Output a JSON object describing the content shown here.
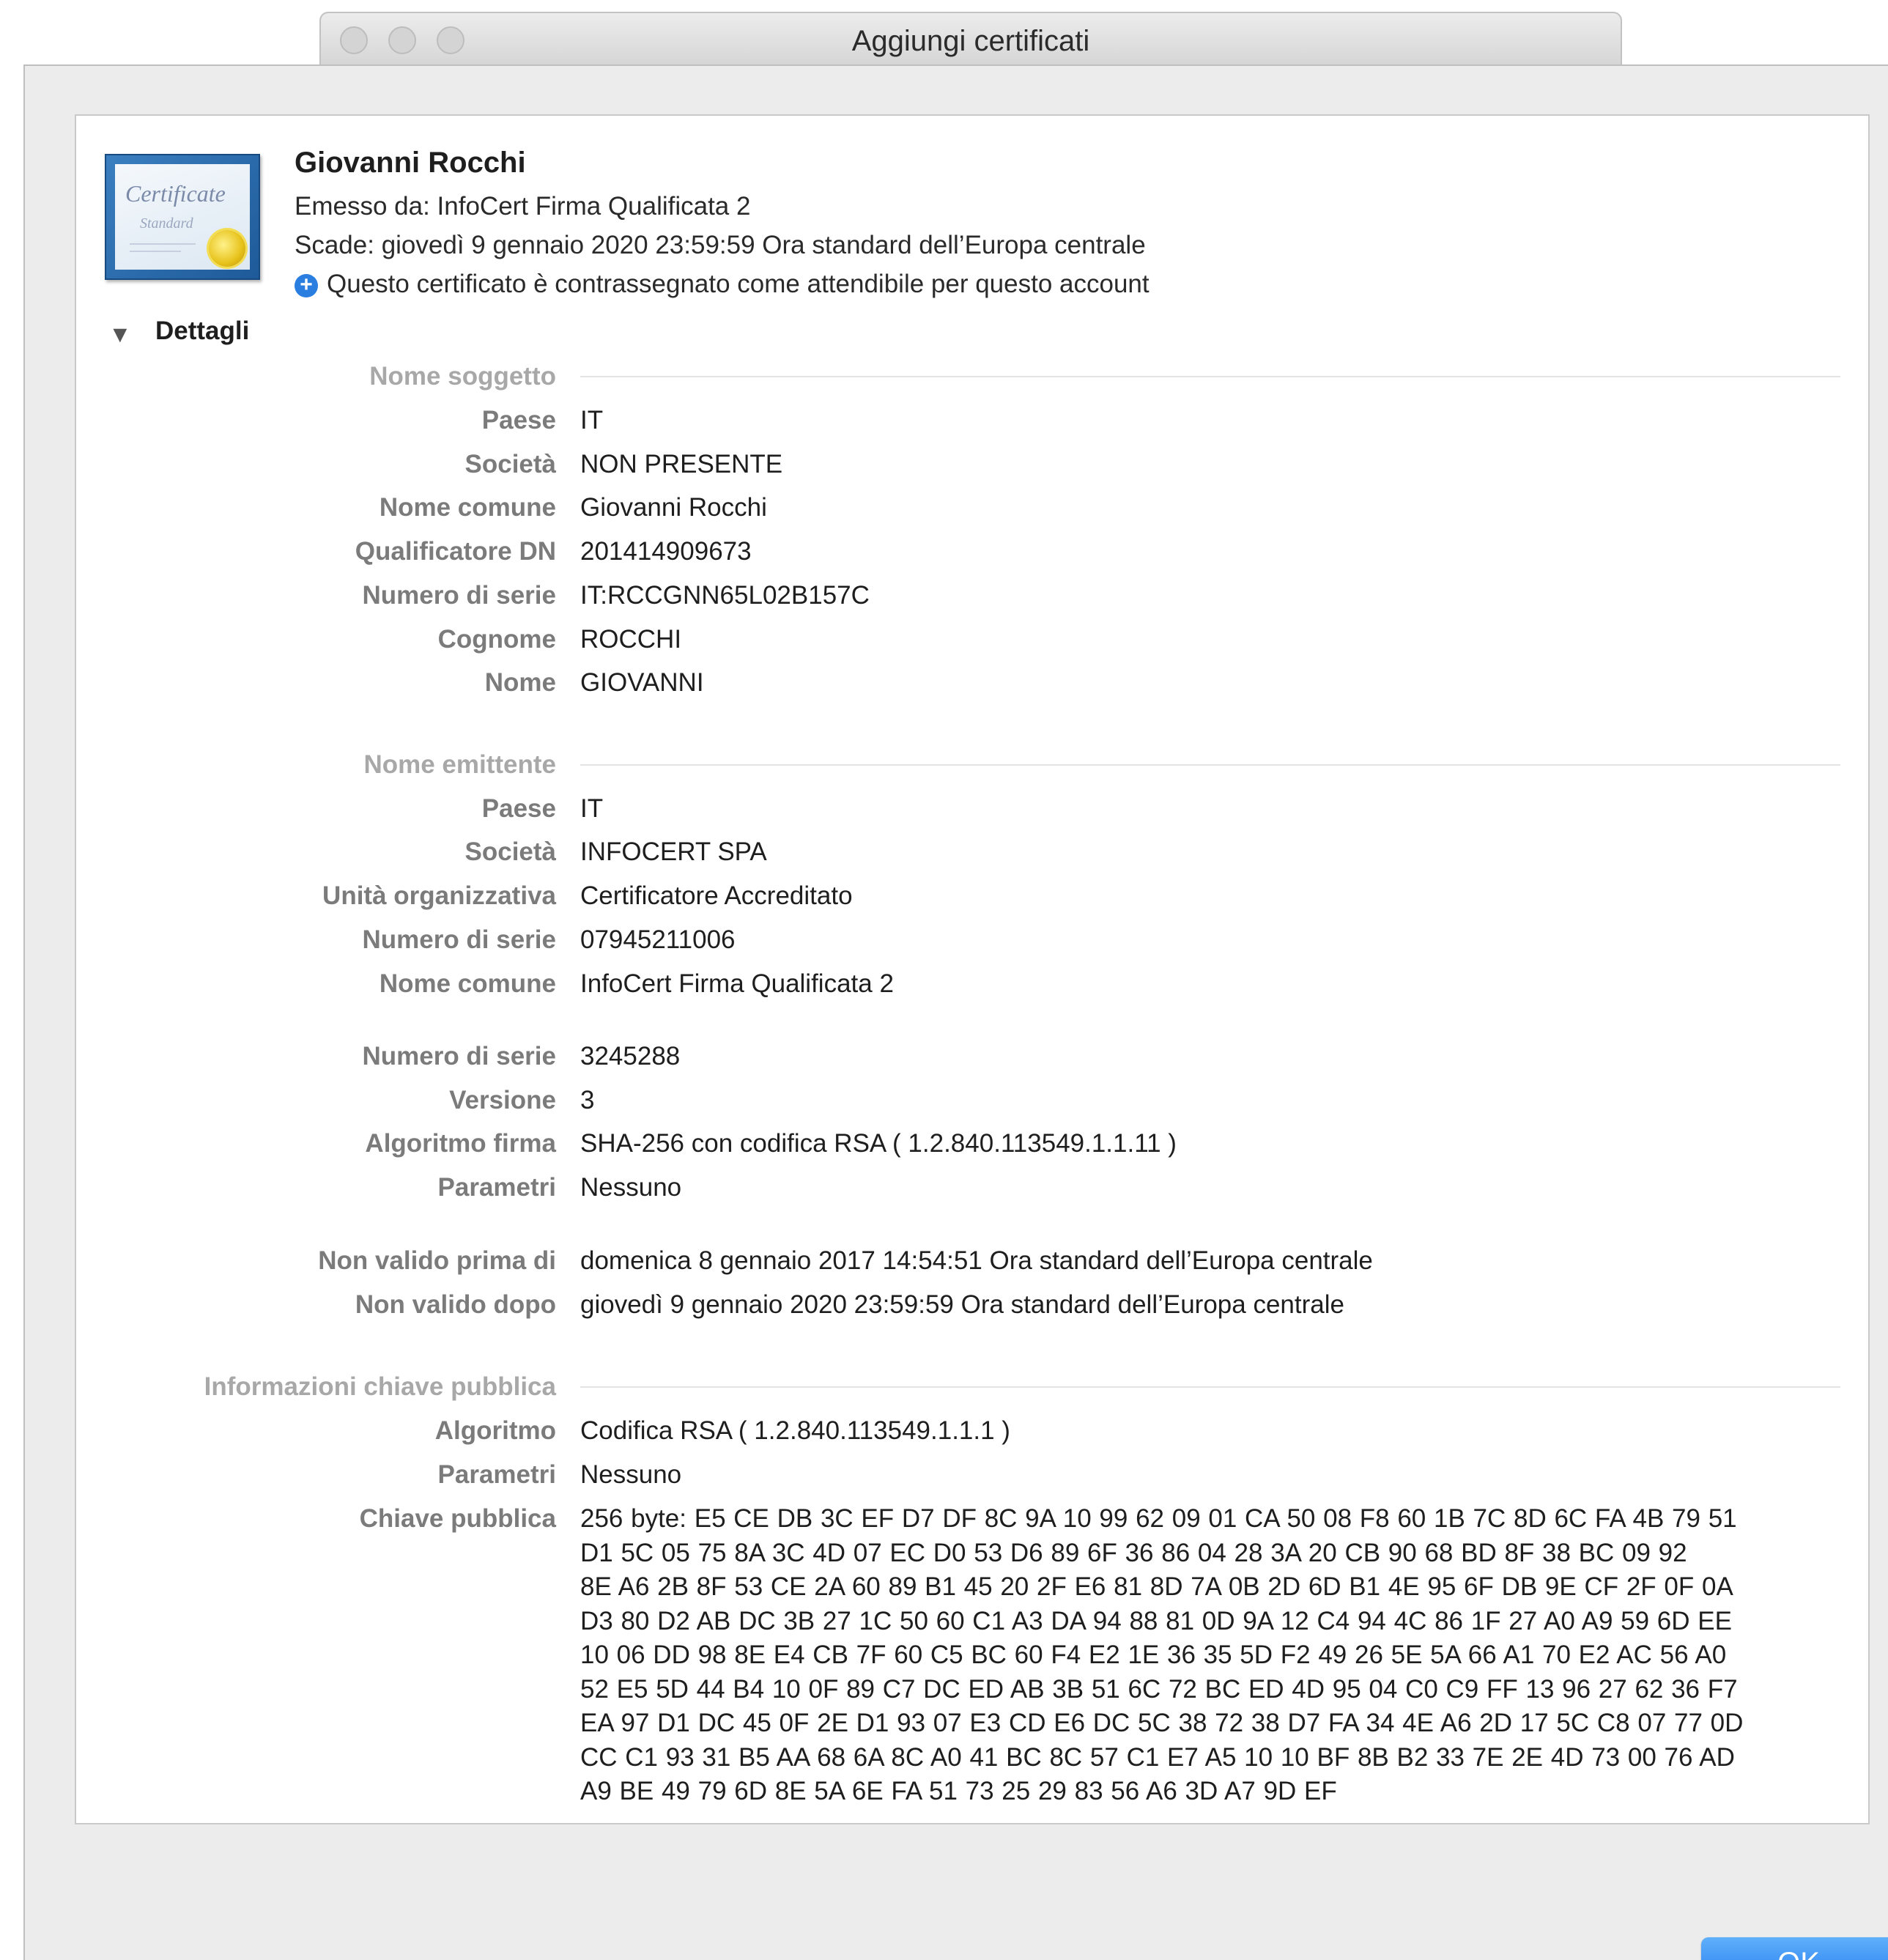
{
  "window": {
    "title": "Aggiungi certificati"
  },
  "certificate": {
    "icon_text": "Certificate",
    "icon_subtext": "Standard",
    "name": "Giovanni Rocchi",
    "issued_by": "Emesso da: InfoCert Firma Qualificata 2",
    "expires": "Scade: giovedì 9 gennaio 2020 23:59:59 Ora standard dell’Europa centrale",
    "trust_note": "Questo certificato è contrassegnato come attendibile per questo account"
  },
  "details": {
    "toggle_label": "Dettagli",
    "subject": {
      "section_label": "Nome soggetto",
      "rows": [
        {
          "label": "Paese",
          "value": "IT"
        },
        {
          "label": "Società",
          "value": "NON PRESENTE"
        },
        {
          "label": "Nome comune",
          "value": "Giovanni Rocchi"
        },
        {
          "label": "Qualificatore DN",
          "value": "201414909673"
        },
        {
          "label": "Numero di serie",
          "value": "IT:RCCGNN65L02B157C"
        },
        {
          "label": "Cognome",
          "value": "ROCCHI"
        },
        {
          "label": "Nome",
          "value": "GIOVANNI"
        }
      ]
    },
    "issuer": {
      "section_label": "Nome emittente",
      "rows": [
        {
          "label": "Paese",
          "value": "IT"
        },
        {
          "label": "Società",
          "value": "INFOCERT SPA"
        },
        {
          "label": "Unità organizzativa",
          "value": "Certificatore Accreditato"
        },
        {
          "label": "Numero di serie",
          "value": "07945211006"
        },
        {
          "label": "Nome comune",
          "value": "InfoCert Firma Qualificata 2"
        }
      ]
    },
    "general": {
      "rows": [
        {
          "label": "Numero di serie",
          "value": "3245288"
        },
        {
          "label": "Versione",
          "value": "3"
        },
        {
          "label": "Algoritmo firma",
          "value": "SHA-256 con codifica RSA ( 1.2.840.113549.1.1.11 )"
        },
        {
          "label": "Parametri",
          "value": "Nessuno"
        }
      ]
    },
    "validity": {
      "rows": [
        {
          "label": "Non valido prima di",
          "value": "domenica 8 gennaio 2017 14:54:51 Ora standard dell’Europa centrale"
        },
        {
          "label": "Non valido dopo",
          "value": "giovedì 9 gennaio 2020 23:59:59 Ora standard dell’Europa centrale"
        }
      ]
    },
    "public_key": {
      "section_label": "Informazioni chiave pubblica",
      "rows": [
        {
          "label": "Algoritmo",
          "value": "Codifica RSA ( 1.2.840.113549.1.1.1 )"
        },
        {
          "label": "Parametri",
          "value": "Nessuno"
        }
      ],
      "key_label": "Chiave pubblica",
      "key_lines": [
        "256 byte: E5 CE DB 3C EF D7 DF 8C 9A 10 99 62 09 01 CA 50 08 F8 60 1B 7C 8D 6C FA 4B 79 51",
        "D1 5C 05 75 8A 3C 4D 07 EC D0 53 D6 89 6F 36 86 04 28 3A 20 CB 90 68 BD 8F 38 BC 09 92",
        "8E A6 2B 8F 53 CE 2A 60 89 B1 45 20 2F E6 81 8D 7A 0B 2D 6D B1 4E 95 6F DB 9E CF 2F 0F 0A",
        "D3 80 D2 AB DC 3B 27 1C 50 60 C1 A3 DA 94 88 81 0D 9A 12 C4 94 4C 86 1F 27 A0 A9 59 6D EE",
        "10 06 DD 98 8E E4 CB 7F 60 C5 BC 60 F4 E2 1E 36 35 5D F2 49 26 5E 5A 66 A1 70 E2 AC 56 A0",
        "52 E5 5D 44 B4 10 0F 89 C7 DC ED AB 3B 51 6C 72 BC ED 4D 95 04 C0 C9 FF 13 96 27 62 36 F7",
        "EA 97 D1 DC 45 0F 2E D1 93 07 E3 CD E6 DC 5C 38 72 38 D7 FA 34 4E A6 2D 17 5C C8 07 77 0D",
        "CC C1 93 31 B5 AA 68 6A 8C A0 41 BC 8C 57 C1 E7 A5 10 10 BF 8B B2 33 7E 2E 4D 73 00 76 AD",
        "A9 BE 49 79 6D 8E 5A 6E FA 51 73 25 29 83 56 A6 3D A7 9D EF"
      ]
    }
  },
  "footer": {
    "ok_label": "OK"
  },
  "icons": {
    "trust": "plus-circle-icon",
    "disclosure": "triangle-down-icon"
  },
  "colors": {
    "accent": "#2a7ee0",
    "ok_button": "#2177ee"
  }
}
